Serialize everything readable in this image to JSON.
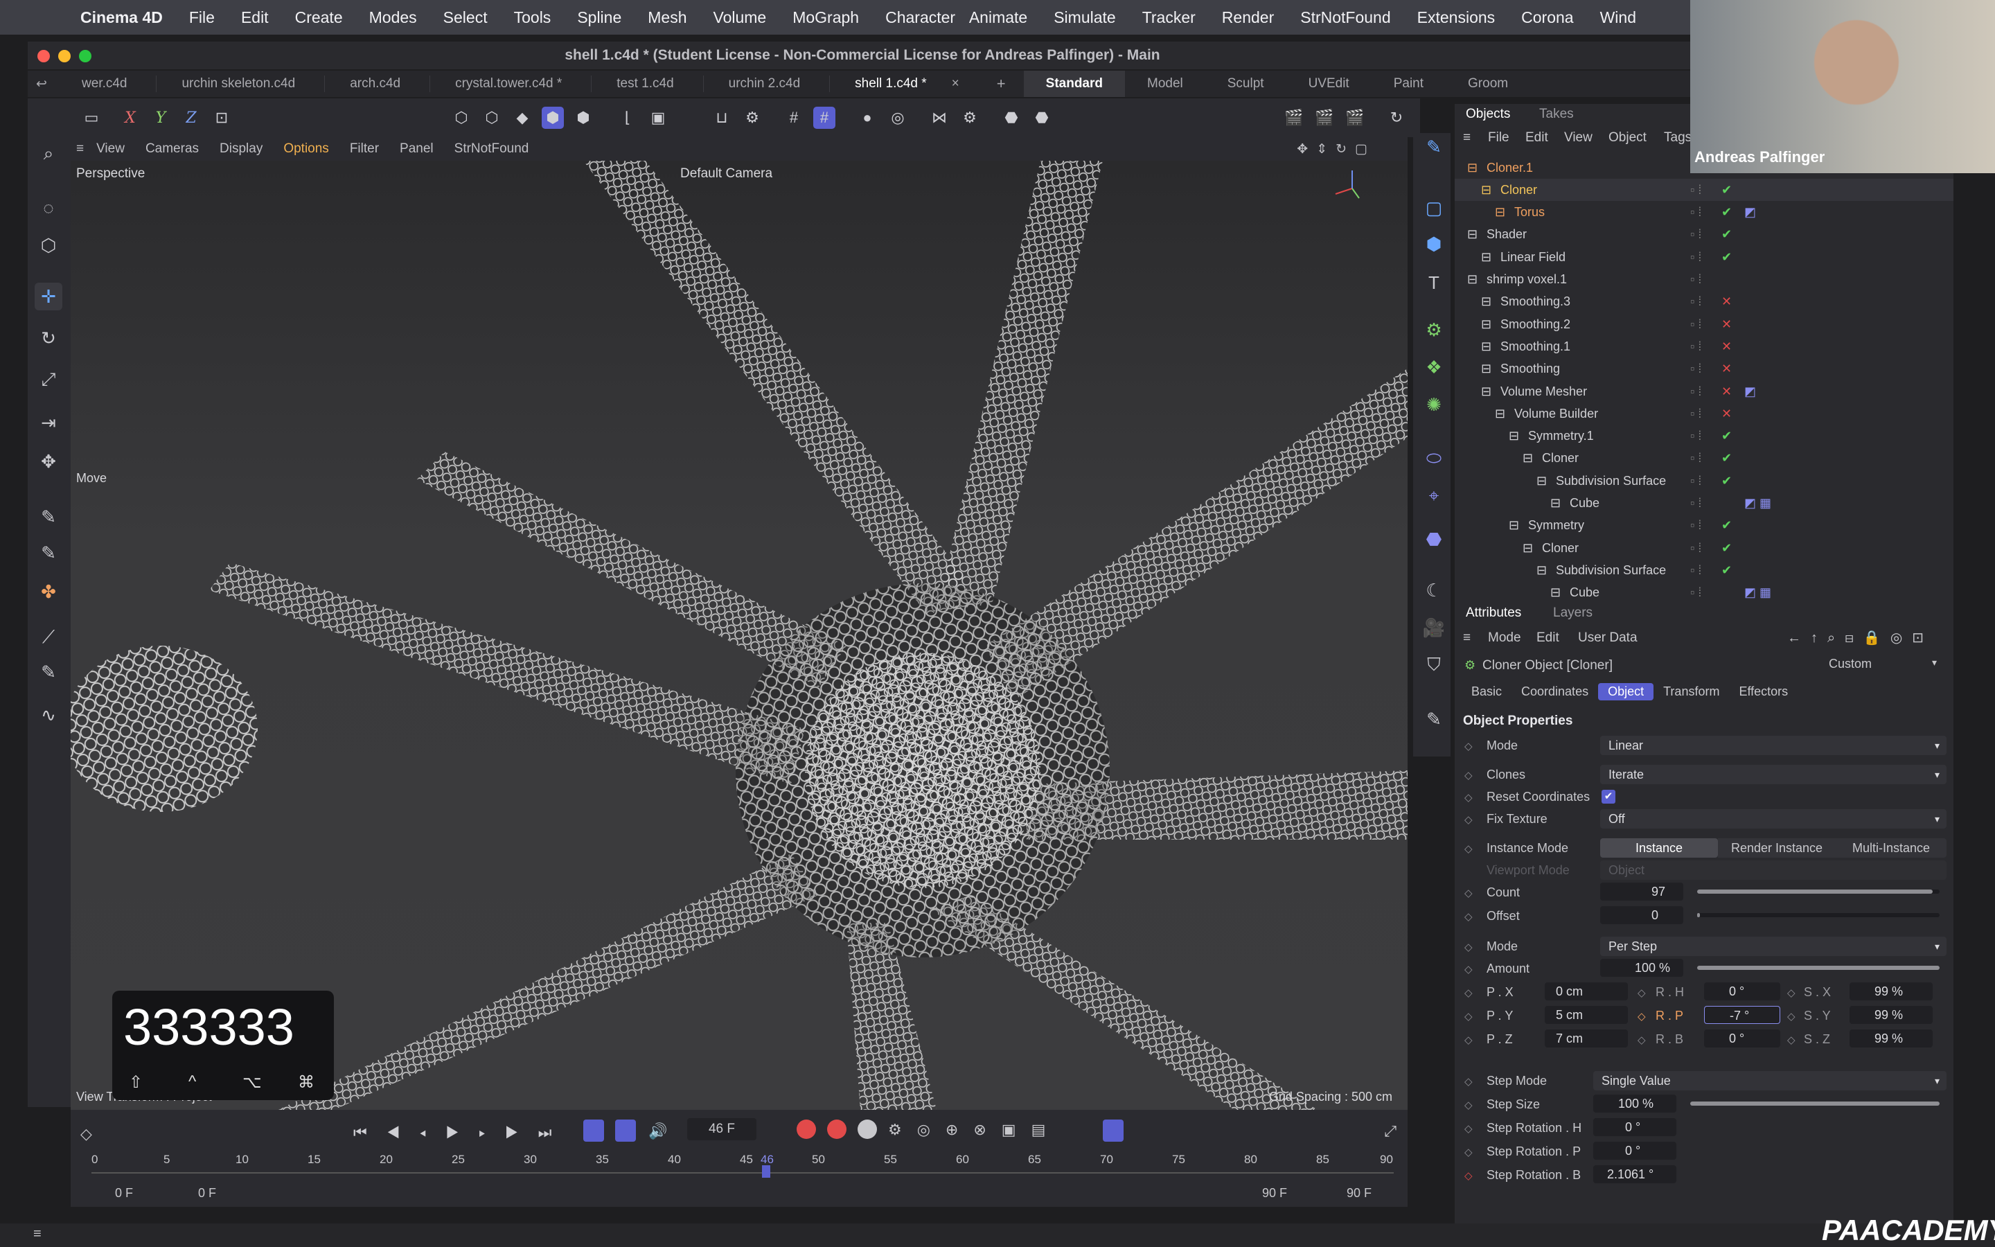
{
  "menubar": {
    "app": "Cinema 4D",
    "items": [
      "File",
      "Edit",
      "Create",
      "Modes",
      "Select",
      "Tools",
      "Spline",
      "Mesh",
      "Volume",
      "MoGraph",
      "Character"
    ],
    "right_items": [
      "Animate",
      "Simulate",
      "Tracker",
      "Render",
      "StrNotFound",
      "Extensions",
      "Corona",
      "Wind"
    ]
  },
  "window": {
    "title": "shell 1.c4d * (Student License - Non-Commercial License for Andreas Palfinger) - Main"
  },
  "tabs": {
    "files": [
      "wer.c4d",
      "urchin skeleton.c4d",
      "arch.c4d",
      "crystal.tower.c4d *",
      "test 1.c4d",
      "urchin 2.c4d",
      "shell 1.c4d *"
    ],
    "close": "×",
    "add": "+",
    "layouts": [
      "Standard",
      "Model",
      "Sculpt",
      "UVEdit",
      "Paint",
      "Groom"
    ]
  },
  "toolbar": {
    "axes": [
      "X",
      "Y",
      "Z"
    ]
  },
  "viewport": {
    "menu": [
      "View",
      "Cameras",
      "Display",
      "Options",
      "Filter",
      "Panel",
      "StrNotFound"
    ],
    "name": "Perspective",
    "camera": "Default Camera",
    "tool_label": "Move",
    "grid_spacing": "Grid Spacing : 500 cm",
    "view_transform": "View Transform : Project",
    "key_overlay": "333333",
    "modifier_keys": [
      "⇧",
      "^",
      "⌥",
      "⌘"
    ]
  },
  "timeline": {
    "current_frame": "46 F",
    "ruler": [
      "0",
      "5",
      "10",
      "15",
      "20",
      "25",
      "30",
      "35",
      "40",
      "45",
      "46",
      "50",
      "55",
      "60",
      "65",
      "70",
      "75",
      "80",
      "85",
      "90"
    ],
    "start": "0 F",
    "start2": "0 F",
    "end": "90 F",
    "end2": "90 F"
  },
  "objects": {
    "tabs": [
      "Objects",
      "Takes"
    ],
    "menu": [
      "File",
      "Edit",
      "View",
      "Object",
      "Tags"
    ],
    "rows": [
      {
        "name": "Cloner.1",
        "indent": 0,
        "color": "#f0a060",
        "check": "",
        "tag": ""
      },
      {
        "name": "Cloner",
        "indent": 1,
        "color": "#f2c45a",
        "check": "✔",
        "tag": ""
      },
      {
        "name": "Torus",
        "indent": 2,
        "color": "#f0a060",
        "check": "✔",
        "tag": "◩"
      },
      {
        "name": "Shader",
        "indent": 0,
        "color": "#d0d0d4",
        "check": "✔",
        "tag": ""
      },
      {
        "name": "Linear Field",
        "indent": 1,
        "color": "#d0d0d4",
        "check": "✔",
        "tag": ""
      },
      {
        "name": "shrimp voxel.1",
        "indent": 0,
        "color": "#d0d0d4",
        "check": "",
        "tag": ""
      },
      {
        "name": "Smoothing.3",
        "indent": 1,
        "color": "#d0d0d4",
        "check": "✕",
        "tag": ""
      },
      {
        "name": "Smoothing.2",
        "indent": 1,
        "color": "#d0d0d4",
        "check": "✕",
        "tag": ""
      },
      {
        "name": "Smoothing.1",
        "indent": 1,
        "color": "#d0d0d4",
        "check": "✕",
        "tag": ""
      },
      {
        "name": "Smoothing",
        "indent": 1,
        "color": "#d0d0d4",
        "check": "✕",
        "tag": ""
      },
      {
        "name": "Volume Mesher",
        "indent": 1,
        "color": "#d0d0d4",
        "check": "✕",
        "tag": "◩"
      },
      {
        "name": "Volume Builder",
        "indent": 2,
        "color": "#d0d0d4",
        "check": "✕",
        "tag": ""
      },
      {
        "name": "Symmetry.1",
        "indent": 3,
        "color": "#d0d0d4",
        "check": "✔",
        "tag": ""
      },
      {
        "name": "Cloner",
        "indent": 4,
        "color": "#d0d0d4",
        "check": "✔",
        "tag": ""
      },
      {
        "name": "Subdivision Surface",
        "indent": 5,
        "color": "#d0d0d4",
        "check": "✔",
        "tag": ""
      },
      {
        "name": "Cube",
        "indent": 6,
        "color": "#d0d0d4",
        "check": "",
        "tag": "◩ ▦"
      },
      {
        "name": "Symmetry",
        "indent": 3,
        "color": "#d0d0d4",
        "check": "✔",
        "tag": ""
      },
      {
        "name": "Cloner",
        "indent": 4,
        "color": "#d0d0d4",
        "check": "✔",
        "tag": ""
      },
      {
        "name": "Subdivision Surface",
        "indent": 5,
        "color": "#d0d0d4",
        "check": "✔",
        "tag": ""
      },
      {
        "name": "Cube",
        "indent": 6,
        "color": "#d0d0d4",
        "check": "",
        "tag": "◩ ▦"
      }
    ]
  },
  "attributes": {
    "tabs": [
      "Attributes",
      "Layers"
    ],
    "menu": [
      "Mode",
      "Edit",
      "User Data"
    ],
    "object_title": "Cloner Object [Cloner]",
    "preset": "Custom",
    "subtabs": [
      "Basic",
      "Coordinates",
      "Object",
      "Transform",
      "Effectors"
    ],
    "section": "Object Properties",
    "mode_label": "Mode",
    "mode_value": "Linear",
    "clones_label": "Clones",
    "clones_value": "Iterate",
    "reset_label": "Reset Coordinates",
    "fix_label": "Fix Texture",
    "fix_value": "Off",
    "instance_label": "Instance Mode",
    "instance_options": [
      "Instance",
      "Render Instance",
      "Multi-Instance"
    ],
    "viewport_label": "Viewport Mode",
    "viewport_value": "Object",
    "count_label": "Count",
    "count_value": "97",
    "offset_label": "Offset",
    "offset_value": "0",
    "mode2_label": "Mode",
    "mode2_value": "Per Step",
    "amount_label": "Amount",
    "amount_value": "100 %",
    "px_label": "P . X",
    "px_value": "0 cm",
    "py_label": "P . Y",
    "py_value": "5 cm",
    "pz_label": "P . Z",
    "pz_value": "7 cm",
    "rh_label": "R . H",
    "rh_value": "0 °",
    "rp_label": "R . P",
    "rp_value": "-7 °",
    "rb_label": "R . B",
    "rb_value": "0 °",
    "sx_label": "S . X",
    "sx_value": "99 %",
    "sy_label": "S . Y",
    "sy_value": "99 %",
    "sz_label": "S . Z",
    "sz_value": "99 %",
    "stepmode_label": "Step Mode",
    "stepmode_value": "Single Value",
    "stepsize_label": "Step Size",
    "stepsize_value": "100 %",
    "steprh_label": "Step Rotation . H",
    "steprh_value": "0 °",
    "steprp_label": "Step Rotation . P",
    "steprp_value": "0 °",
    "steprb_label": "Step Rotation . B",
    "steprb_value": "2.1061 °",
    "count_fraction": 0.97,
    "amount_fraction": 1.0,
    "stepsize_fraction": 1.0
  },
  "webcam": {
    "name": "Andreas Palfinger"
  },
  "brand": "PAACADEMY",
  "colors": {
    "accent": "#5a5fd0",
    "check_green": "#5ed35e",
    "cross_red": "#e24a4a",
    "orange": "#f0a060"
  }
}
